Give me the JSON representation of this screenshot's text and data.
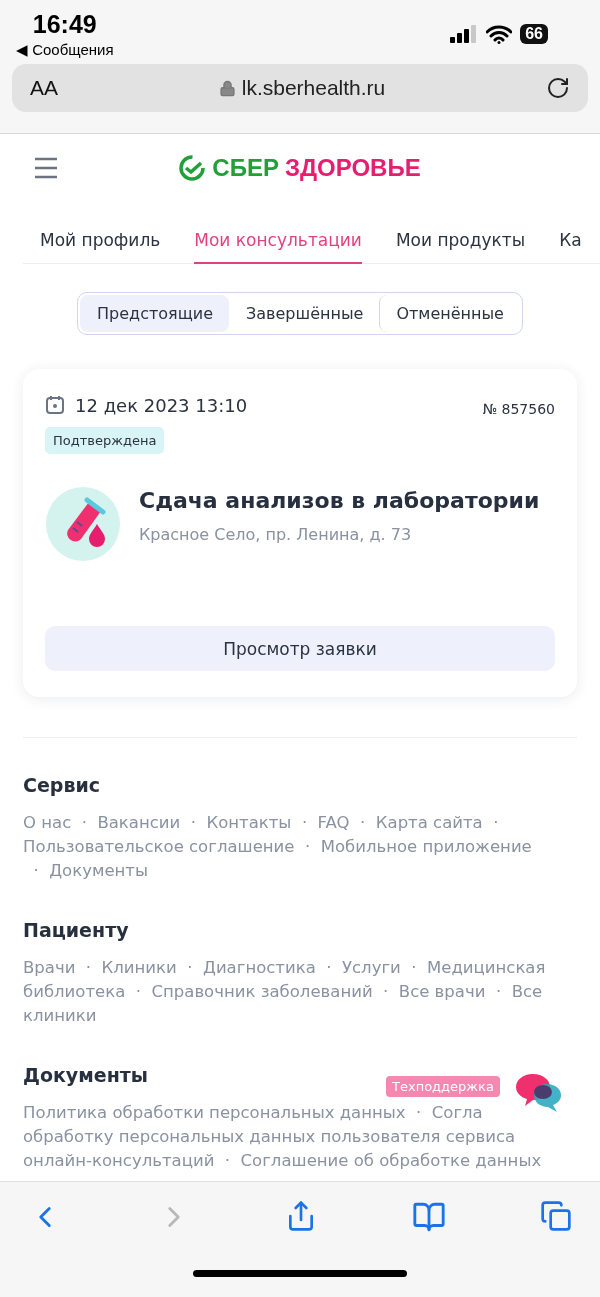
{
  "status_bar": {
    "time": "16:49",
    "back_app": "◀ Сообщения",
    "battery": "66"
  },
  "address_bar": {
    "text_size": "AA",
    "url": "lk.sberhealth.ru"
  },
  "logo": {
    "part_1": "СБЕР",
    "part_2": "ЗДОРОВЬЕ"
  },
  "nav_tabs": [
    {
      "label": "Мой профиль",
      "selected": false
    },
    {
      "label": "Мои консультации",
      "selected": true
    },
    {
      "label": "Мои продукты",
      "selected": false
    },
    {
      "label": "Ка",
      "selected": false
    }
  ],
  "segments": [
    {
      "label": "Предстоящие",
      "selected": true
    },
    {
      "label": "Завершённые",
      "selected": false
    },
    {
      "label": "Отменённые",
      "selected": false
    }
  ],
  "appointment": {
    "date": "12 дек 2023 13:10",
    "number": "№ 857560",
    "status": "Подтверждена",
    "title": "Сдача анализов в лаборатории",
    "address": "Красное Село, пр. Ленина, д. 73",
    "button": "Просмотр заявки"
  },
  "footer": {
    "sections": [
      {
        "title": "Сервис",
        "lines": [
          "О нас  ·  Вакансии  ·  Контакты  ·  FAQ  ·  Карта сайта  ·",
          "Пользовательское соглашение  ·  Мобильное приложение",
          "  ·  Документы"
        ]
      },
      {
        "title": "Пациенту",
        "lines": [
          "Врачи  ·  Клиники  ·  Диагностика  ·  Услуги  ·  Медицинская",
          "библиотека  ·  Справочник заболеваний  ·  Все врачи  ·  Все",
          "клиники"
        ]
      },
      {
        "title": "Документы",
        "lines": [
          "Политика обработки персональных данных  ·  Согла",
          "обработку персональных данных пользователя сервиса",
          "онлайн-консультаций  ·  Соглашение об обработке данных"
        ]
      }
    ]
  },
  "support": {
    "label": "Техподдержка"
  }
}
